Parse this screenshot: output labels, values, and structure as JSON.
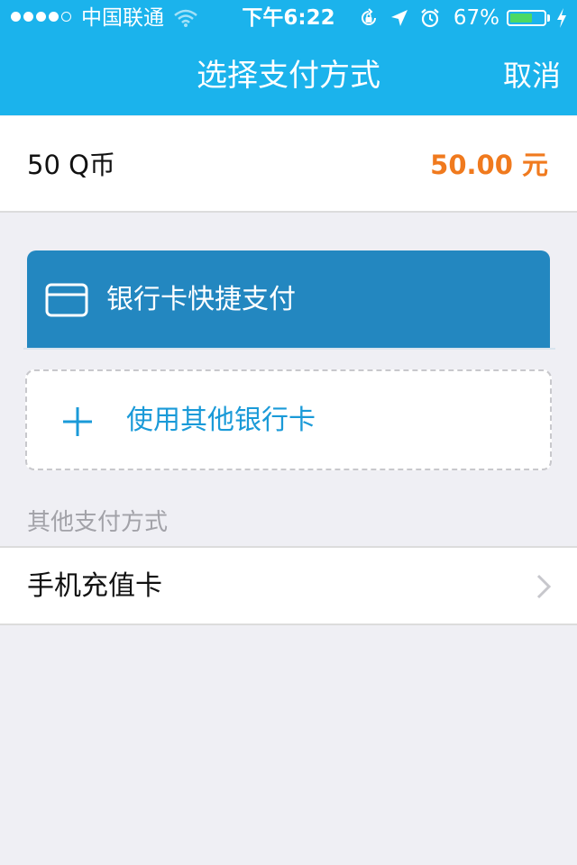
{
  "status_bar": {
    "carrier": "中国联通",
    "time": "下午6:22",
    "battery_percent": "67%",
    "battery_level": 0.67
  },
  "nav": {
    "title": "选择支付方式",
    "cancel_label": "取消"
  },
  "product": {
    "name": "50 Q币",
    "price": "50.00 元"
  },
  "bank_card": {
    "label": "银行卡快捷支付",
    "icon": "credit-card-icon"
  },
  "other_card": {
    "label": "使用其他银行卡",
    "icon": "plus-icon"
  },
  "other_methods": {
    "header": "其他支付方式",
    "items": [
      {
        "label": "手机充值卡",
        "icon": "chevron-right-icon"
      }
    ]
  },
  "colors": {
    "nav_blue": "#1bb3ec",
    "card_blue": "#2387c0",
    "price_orange": "#f07a1e",
    "link_blue": "#1a9ad8",
    "battery_green": "#4cd964"
  }
}
